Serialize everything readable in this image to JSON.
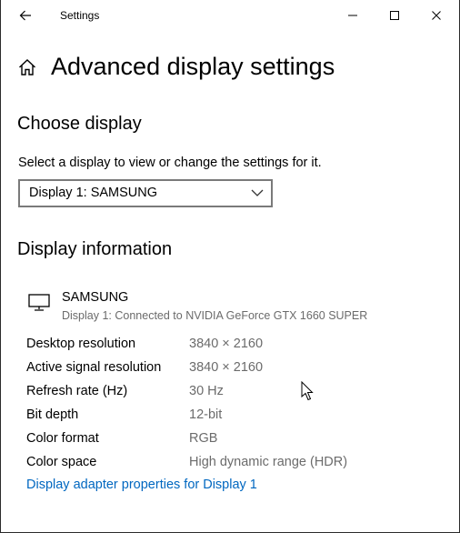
{
  "titlebar": {
    "title": "Settings",
    "back_icon": "back-arrow-icon",
    "minimize_icon": "minimize-icon",
    "maximize_icon": "maximize-icon",
    "close_icon": "close-icon"
  },
  "header": {
    "home_icon": "home-icon",
    "title": "Advanced display settings"
  },
  "choose_display": {
    "heading": "Choose display",
    "description": "Select a display to view or change the settings for it.",
    "selected": "Display 1: SAMSUNG"
  },
  "display_info": {
    "heading": "Display information",
    "monitor_icon": "monitor-icon",
    "name": "SAMSUNG",
    "subtitle": "Display 1: Connected to NVIDIA GeForce GTX 1660 SUPER",
    "rows": [
      {
        "label": "Desktop resolution",
        "value": "3840 × 2160"
      },
      {
        "label": "Active signal resolution",
        "value": "3840 × 2160"
      },
      {
        "label": "Refresh rate (Hz)",
        "value": "30 Hz"
      },
      {
        "label": "Bit depth",
        "value": "12-bit"
      },
      {
        "label": "Color format",
        "value": "RGB"
      },
      {
        "label": "Color space",
        "value": "High dynamic range (HDR)"
      }
    ],
    "adapter_link": "Display adapter properties for Display 1"
  },
  "colors": {
    "link": "#0067c0",
    "secondary_text": "#6b6b6b",
    "border": "#7a7a7a"
  }
}
